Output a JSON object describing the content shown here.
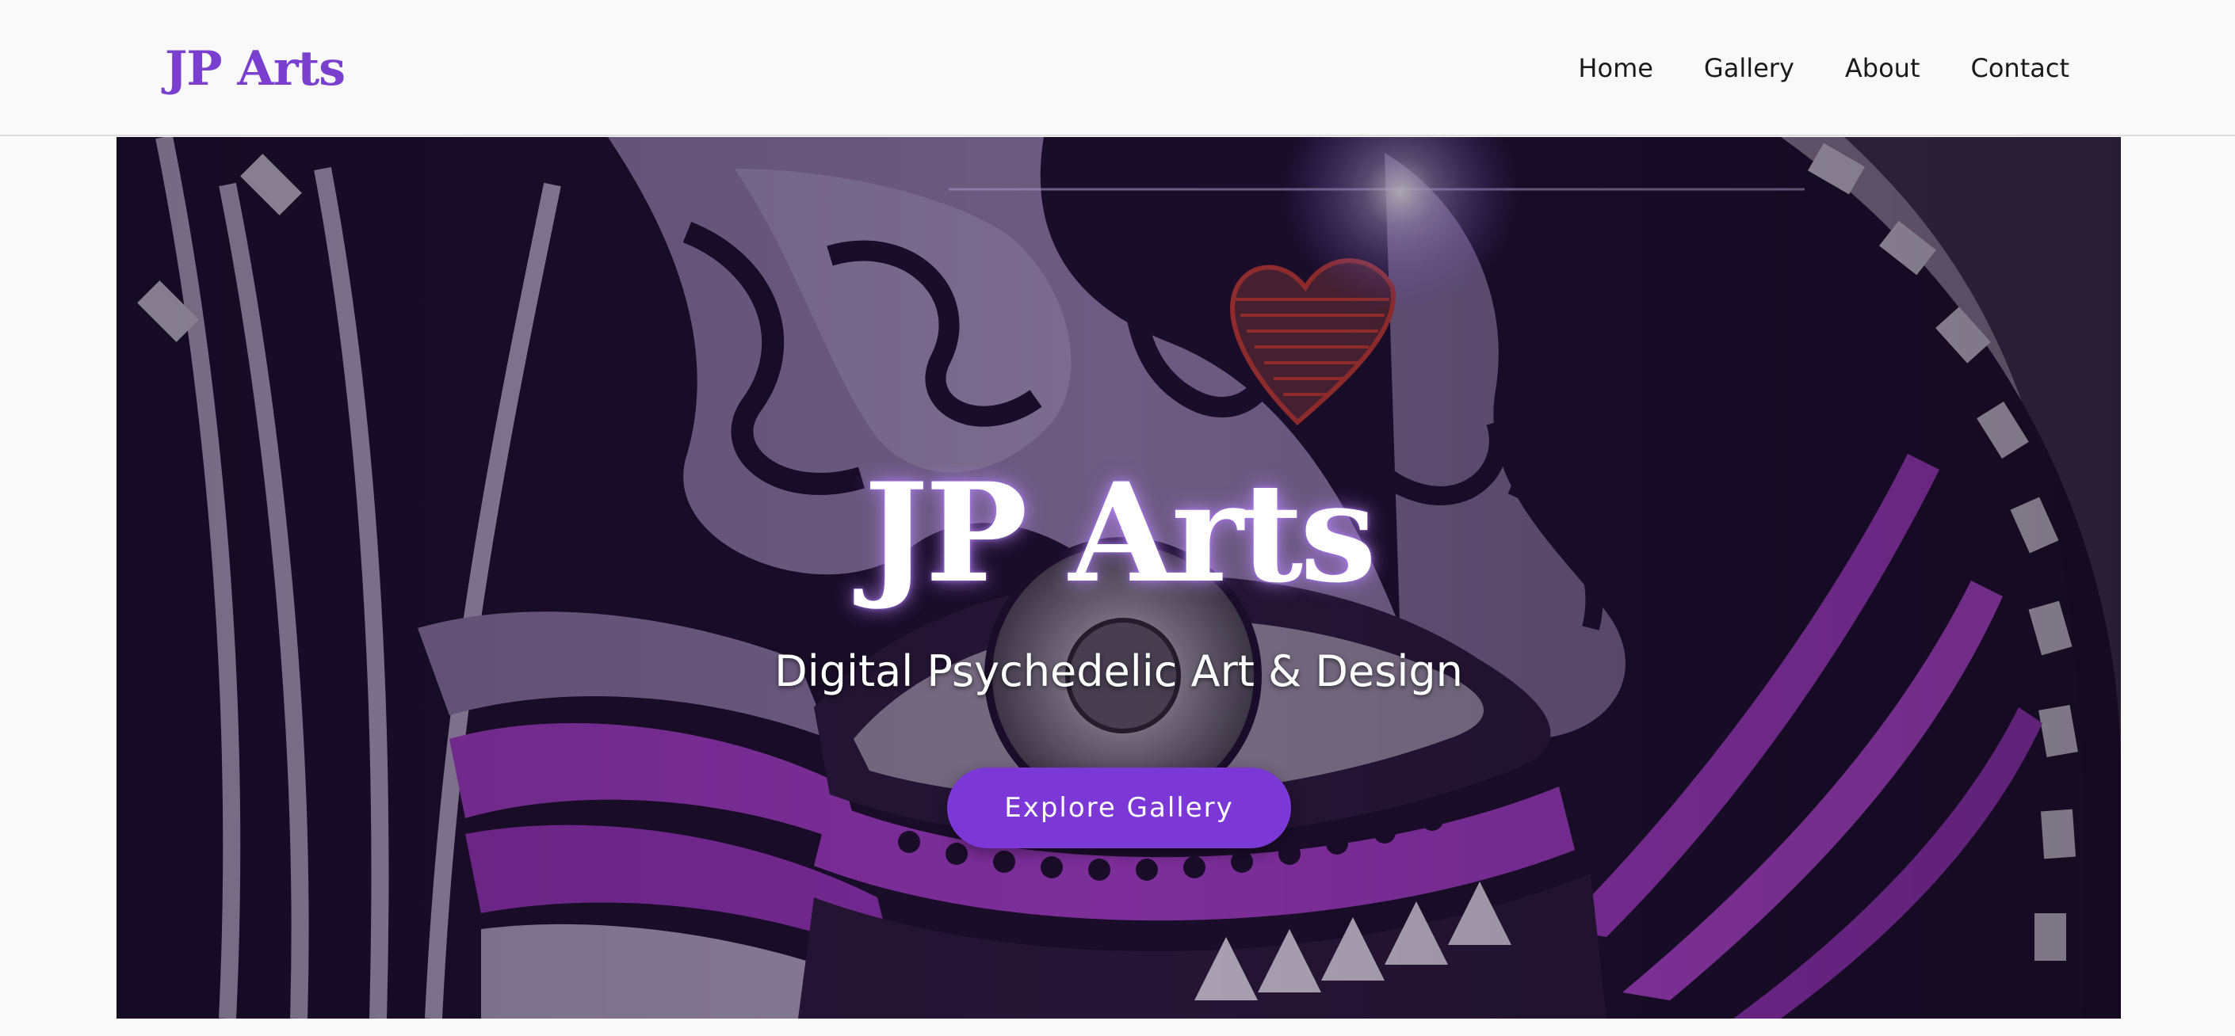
{
  "header": {
    "logo": "JP Arts",
    "nav": [
      "Home",
      "Gallery",
      "About",
      "Contact"
    ]
  },
  "hero": {
    "title": "JP Arts",
    "subtitle": "Digital Psychedelic Art & Design",
    "cta_label": "Explore Gallery",
    "background_image": "psychedelic-eye-artwork"
  },
  "colors": {
    "accent": "#7b3fd0",
    "button": "#7b38d6",
    "hero_dark": "#1c0f2e",
    "hero_lavender": "#8f7aa8",
    "hero_magenta": "#a63cc9",
    "heart_red": "#c23a32"
  }
}
